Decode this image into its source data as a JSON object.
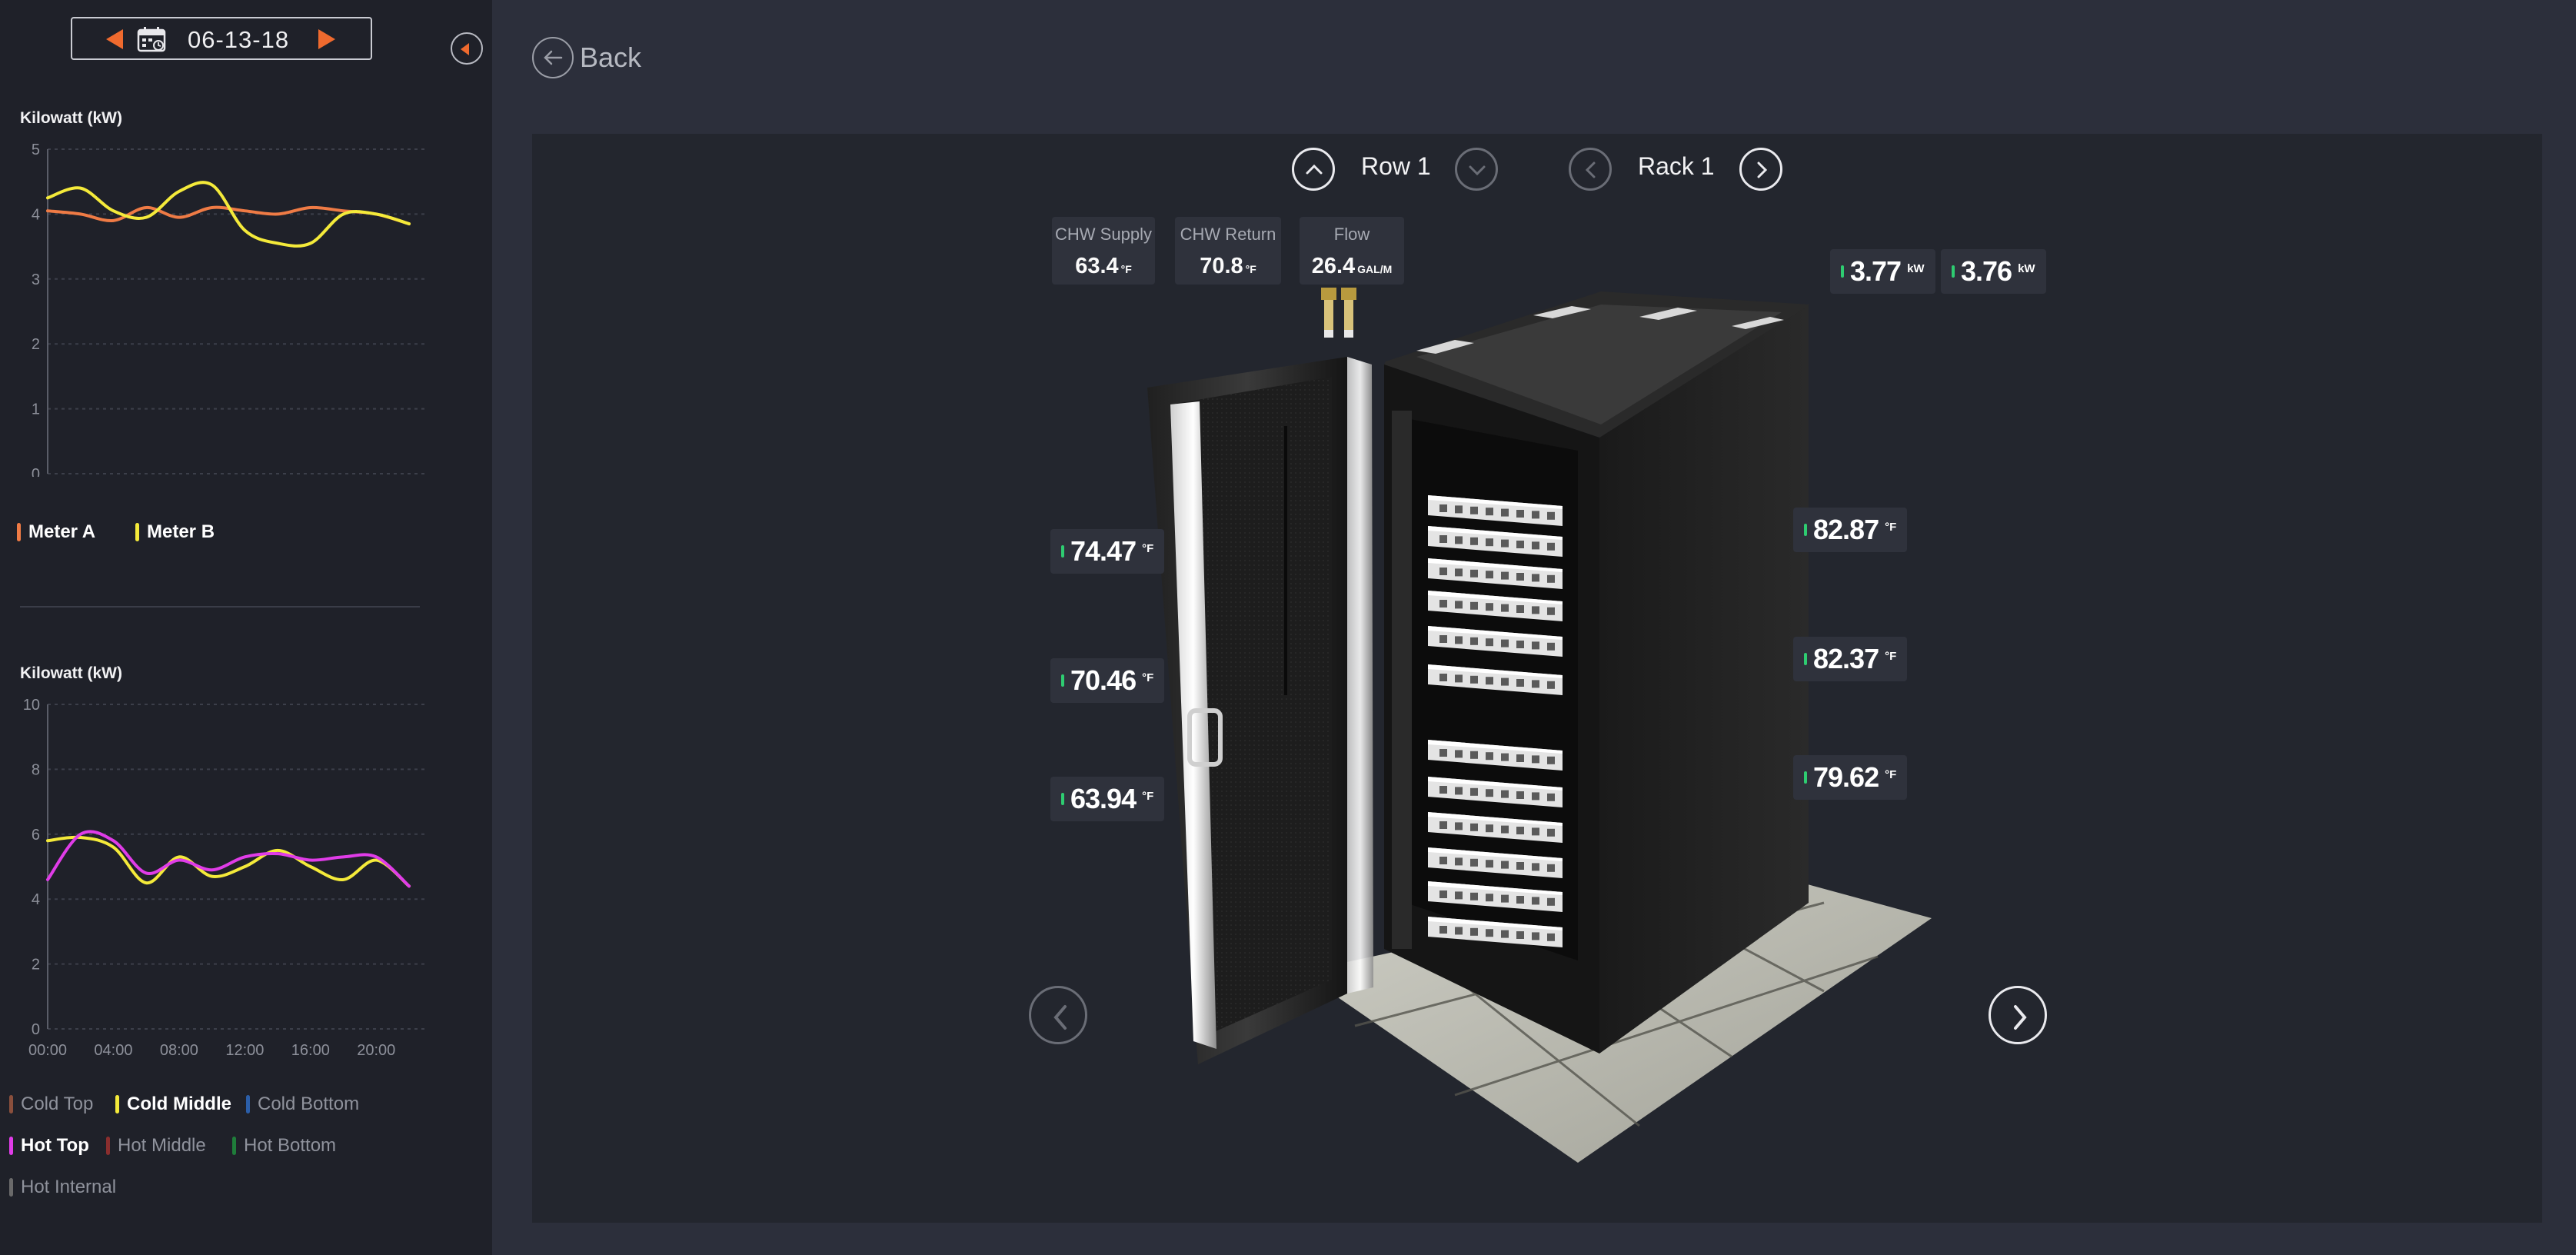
{
  "sidebar": {
    "date": "06-13-18",
    "chart1": {
      "title": "Kilowatt (kW)",
      "y_ticks": [
        "0",
        "1",
        "2",
        "3",
        "4",
        "5"
      ],
      "x_ticks": [
        "00:00",
        "04:00",
        "08:00",
        "12:00",
        "16:00",
        "20:00"
      ],
      "legend": [
        {
          "label": "Meter A",
          "color": "#ef7b45",
          "active": true
        },
        {
          "label": "Meter B",
          "color": "#f4ea3a",
          "active": true
        }
      ]
    },
    "chart2": {
      "title": "Kilowatt (kW)",
      "y_ticks": [
        "0",
        "2",
        "4",
        "6",
        "8",
        "10"
      ],
      "x_ticks": [
        "00:00",
        "04:00",
        "08:00",
        "12:00",
        "16:00",
        "20:00"
      ],
      "legend": [
        {
          "label": "Cold Top",
          "color": "#8a4f3c",
          "active": false
        },
        {
          "label": "Cold Middle",
          "color": "#f4ea3a",
          "active": true
        },
        {
          "label": "Cold Bottom",
          "color": "#2b5ea8",
          "active": false
        },
        {
          "label": "Hot Top",
          "color": "#e03ce8",
          "active": true
        },
        {
          "label": "Hot Middle",
          "color": "#8a2e2e",
          "active": false
        },
        {
          "label": "Hot Bottom",
          "color": "#1f7d3a",
          "active": false
        },
        {
          "label": "Hot Internal",
          "color": "#6a6a6a",
          "active": false
        }
      ]
    }
  },
  "chart_data": [
    {
      "type": "line",
      "title": "",
      "ylabel": "Kilowatt (kW)",
      "ylim": [
        0,
        5
      ],
      "x": [
        0,
        2,
        4,
        6,
        8,
        10,
        12,
        14,
        16,
        18,
        20,
        22
      ],
      "x_tick_labels": [
        "00:00",
        "04:00",
        "08:00",
        "12:00",
        "16:00",
        "20:00"
      ],
      "series": [
        {
          "name": "Meter A",
          "color": "#ef7b45",
          "values": [
            4.05,
            4.0,
            3.9,
            4.1,
            3.95,
            4.1,
            4.05,
            4.0,
            4.1,
            4.05,
            4.0,
            3.85
          ]
        },
        {
          "name": "Meter B",
          "color": "#f4ea3a",
          "values": [
            4.25,
            4.4,
            4.05,
            3.95,
            4.35,
            4.45,
            3.75,
            3.55,
            3.55,
            4.0,
            4.0,
            3.85
          ]
        }
      ]
    },
    {
      "type": "line",
      "title": "",
      "ylabel": "Kilowatt (kW)",
      "ylim": [
        0,
        10
      ],
      "x": [
        0,
        2,
        4,
        6,
        8,
        10,
        12,
        14,
        16,
        18,
        20,
        22
      ],
      "x_tick_labels": [
        "00:00",
        "04:00",
        "08:00",
        "12:00",
        "16:00",
        "20:00"
      ],
      "series": [
        {
          "name": "Cold Middle",
          "color": "#f4ea3a",
          "values": [
            5.8,
            5.9,
            5.6,
            4.5,
            5.3,
            4.7,
            5.0,
            5.5,
            5.0,
            4.6,
            5.2,
            4.4
          ]
        },
        {
          "name": "Hot Top",
          "color": "#e03ce8",
          "values": [
            4.6,
            6.0,
            5.8,
            4.8,
            5.2,
            4.9,
            5.3,
            5.4,
            5.2,
            5.3,
            5.3,
            4.4
          ]
        }
      ]
    }
  ],
  "main": {
    "back_label": "Back",
    "row_label": "Row 1",
    "rack_label": "Rack 1",
    "sensors": [
      {
        "caption": "CHW Supply",
        "value": "63.4",
        "unit": "°F"
      },
      {
        "caption": "CHW Return",
        "value": "70.8",
        "unit": "°F"
      },
      {
        "caption": "Flow",
        "value": "26.4",
        "unit": "GAL/M"
      }
    ],
    "power_readings": [
      {
        "value": "3.77",
        "unit": "kW"
      },
      {
        "value": "3.76",
        "unit": "kW"
      }
    ],
    "left_temps": [
      {
        "value": "74.47",
        "unit": "°F"
      },
      {
        "value": "70.46",
        "unit": "°F"
      },
      {
        "value": "63.94",
        "unit": "°F"
      }
    ],
    "right_temps": [
      {
        "value": "82.87",
        "unit": "°F"
      },
      {
        "value": "82.37",
        "unit": "°F"
      },
      {
        "value": "79.62",
        "unit": "°F"
      }
    ]
  }
}
